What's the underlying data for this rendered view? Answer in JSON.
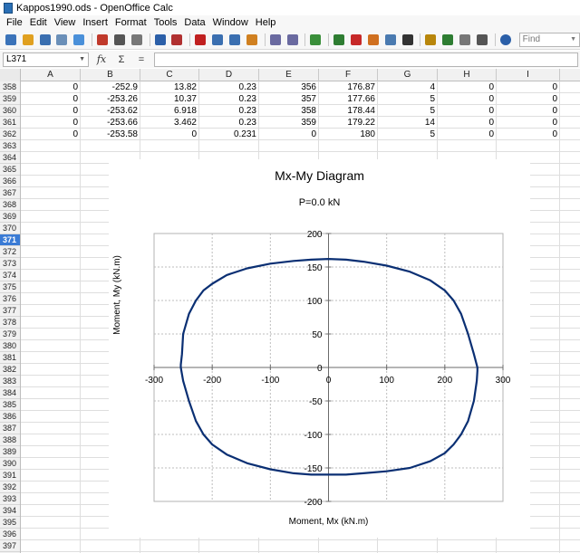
{
  "window": {
    "title": "Kappos1990.ods - OpenOffice Calc"
  },
  "menu": [
    "File",
    "Edit",
    "View",
    "Insert",
    "Format",
    "Tools",
    "Data",
    "Window",
    "Help"
  ],
  "toolbar": {
    "find_placeholder": "Find",
    "icons": [
      "new-icon",
      "open-icon",
      "save-icon",
      "email-icon",
      "edit-file-icon",
      "export-pdf-icon",
      "print-icon",
      "page-preview-icon",
      "spellcheck-icon",
      "autospellcheck-icon",
      "cut-icon",
      "copy-icon",
      "paste-icon",
      "clone-formatting-icon",
      "undo-icon",
      "redo-icon",
      "hyperlink-icon",
      "sort-ascending-icon",
      "sort-descending-icon",
      "chart-icon",
      "draw-functions-icon",
      "find-replace-icon",
      "navigator-icon",
      "gallery-icon",
      "data-sources-icon",
      "zoom-icon",
      "help-icon"
    ]
  },
  "formula_bar": {
    "name_box": "L371",
    "formula": ""
  },
  "columns": [
    "A",
    "B",
    "C",
    "D",
    "E",
    "F",
    "G",
    "H",
    "I"
  ],
  "rows": [
    {
      "num": "358",
      "cells": [
        "0",
        "-252.9",
        "13.82",
        "0.23",
        "356",
        "176.87",
        "4",
        "0",
        "0"
      ]
    },
    {
      "num": "359",
      "cells": [
        "0",
        "-253.26",
        "10.37",
        "0.23",
        "357",
        "177.66",
        "5",
        "0",
        "0"
      ]
    },
    {
      "num": "360",
      "cells": [
        "0",
        "-253.62",
        "6.918",
        "0.23",
        "358",
        "178.44",
        "5",
        "0",
        "0"
      ]
    },
    {
      "num": "361",
      "cells": [
        "0",
        "-253.66",
        "3.462",
        "0.23",
        "359",
        "179.22",
        "14",
        "0",
        "0"
      ]
    },
    {
      "num": "362",
      "cells": [
        "0",
        "-253.58",
        "0",
        "0.231",
        "0",
        "180",
        "5",
        "0",
        "0"
      ]
    }
  ],
  "empty_rows": [
    "363",
    "364",
    "365",
    "366",
    "367",
    "368",
    "369",
    "370",
    "371",
    "372",
    "373",
    "374",
    "375",
    "376",
    "377",
    "378",
    "379",
    "380",
    "381",
    "382",
    "383",
    "384",
    "385",
    "386",
    "387",
    "388",
    "389",
    "390",
    "391",
    "392",
    "393",
    "394",
    "395",
    "396",
    "397"
  ],
  "active_row": "371",
  "chart_data": {
    "type": "line",
    "title": "Mx-My Diagram",
    "subtitle": "P=0.0 kN",
    "xlabel": "Moment, Mx (kN.m)",
    "ylabel": "Moment, My (kN.m)",
    "xlim": [
      -300,
      300
    ],
    "ylim": [
      -200,
      200
    ],
    "xticks": [
      -300,
      -200,
      -100,
      0,
      100,
      200,
      300
    ],
    "yticks": [
      -200,
      -150,
      -100,
      -50,
      0,
      50,
      100,
      150,
      200
    ],
    "grid": true,
    "line_color": "#0a2f73",
    "series": [
      {
        "x": [
          0,
          30,
          60,
          100,
          140,
          175,
          200,
          215,
          228,
          240,
          250,
          256,
          256,
          255,
          250,
          240,
          228,
          215,
          200,
          175,
          140,
          100,
          60,
          30,
          0,
          -30,
          -60,
          -100,
          -140,
          -175,
          -200,
          -215,
          -228,
          -240,
          -250,
          -254,
          -254,
          -252,
          -250,
          -240,
          -228,
          -215,
          -200,
          -175,
          -140,
          -100,
          -60,
          -30,
          0
        ],
        "y": [
          162,
          161,
          158,
          152,
          143,
          130,
          115,
          100,
          80,
          50,
          20,
          0,
          -5,
          -20,
          -50,
          -80,
          -100,
          -115,
          -128,
          -140,
          -150,
          -155,
          -158,
          -160,
          -160,
          -160,
          -158,
          -152,
          -143,
          -130,
          -115,
          -100,
          -80,
          -50,
          -20,
          0,
          4,
          20,
          50,
          80,
          100,
          115,
          125,
          138,
          148,
          155,
          159,
          161,
          162
        ]
      }
    ]
  }
}
